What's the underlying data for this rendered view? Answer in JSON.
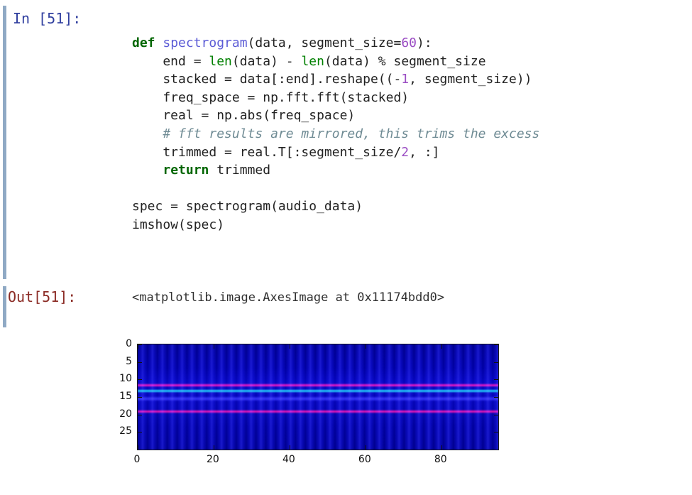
{
  "cell": {
    "in_prompt": "In [51]:",
    "out_prompt": "Out[51]:",
    "accent_bar_color": "#8fa9c4",
    "in_prompt_color": "#303f9f",
    "out_prompt_color": "#8b2b25"
  },
  "code": {
    "lines": [
      [
        {
          "t": "def ",
          "c": "kw"
        },
        {
          "t": "spectrogram",
          "c": "fname"
        },
        {
          "t": "(data, segment_size=",
          "c": "plain"
        },
        {
          "t": "60",
          "c": "num"
        },
        {
          "t": "):",
          "c": "plain"
        }
      ],
      [
        {
          "t": "    end = ",
          "c": "plain"
        },
        {
          "t": "len",
          "c": "builtin"
        },
        {
          "t": "(data) - ",
          "c": "plain"
        },
        {
          "t": "len",
          "c": "builtin"
        },
        {
          "t": "(data) % segment_size",
          "c": "plain"
        }
      ],
      [
        {
          "t": "    stacked = data[:end].reshape((-",
          "c": "plain"
        },
        {
          "t": "1",
          "c": "num"
        },
        {
          "t": ", segment_size))",
          "c": "plain"
        }
      ],
      [
        {
          "t": "    freq_space = np.fft.fft(stacked)",
          "c": "plain"
        }
      ],
      [
        {
          "t": "    real = np.abs(freq_space)",
          "c": "plain"
        }
      ],
      [
        {
          "t": "    # fft results are mirrored, this trims the excess",
          "c": "comment"
        }
      ],
      [
        {
          "t": "    trimmed = real.T[:segment_size/",
          "c": "plain"
        },
        {
          "t": "2",
          "c": "num"
        },
        {
          "t": ", :]",
          "c": "plain"
        }
      ],
      [
        {
          "t": "    ",
          "c": "plain"
        },
        {
          "t": "return",
          "c": "kw"
        },
        {
          "t": " trimmed",
          "c": "plain"
        }
      ],
      [],
      [
        {
          "t": "spec = spectrogram(audio_data)",
          "c": "plain"
        }
      ],
      [
        {
          "t": "imshow(spec)",
          "c": "plain"
        }
      ]
    ]
  },
  "output": {
    "text": "<matplotlib.image.AxesImage at 0x11174bdd0>"
  },
  "chart_data": {
    "type": "heatmap",
    "title": "",
    "xlabel": "",
    "ylabel": "",
    "colormap": "jet",
    "grid": false,
    "legend": "none",
    "origin": "upper",
    "xlim": [
      0,
      95
    ],
    "ylim": [
      29,
      0
    ],
    "xticks": [
      0,
      20,
      40,
      60,
      80
    ],
    "xtick_labels": [
      "0",
      "20",
      "40",
      "60",
      "80"
    ],
    "yticks": [
      0,
      5,
      10,
      15,
      20,
      25
    ],
    "ytick_labels": [
      "0",
      "5",
      "10",
      "15",
      "20",
      "25"
    ],
    "n_rows": 30,
    "n_cols": 95,
    "description": "FFT magnitude spectrogram: dark blue background with vertical time striping, a bright red band at frequency bin 12 with a cyan/light-blue band at bin 13, and a second red band at bin 19.",
    "bands": [
      {
        "row": 11.6,
        "color": "#e01000",
        "label": "red-band-upper",
        "thickness": 5
      },
      {
        "row": 13.2,
        "color": "#18c8e0",
        "label": "cyan-band",
        "thickness": 5
      },
      {
        "row": 15.5,
        "color": "#2a2ad0",
        "label": "faint-blue-band",
        "thickness": 7
      },
      {
        "row": 19.1,
        "color": "#e01000",
        "label": "red-band-lower",
        "thickness": 5
      }
    ],
    "background_color": "#00008f",
    "stripe_period_cols": 1.3
  }
}
